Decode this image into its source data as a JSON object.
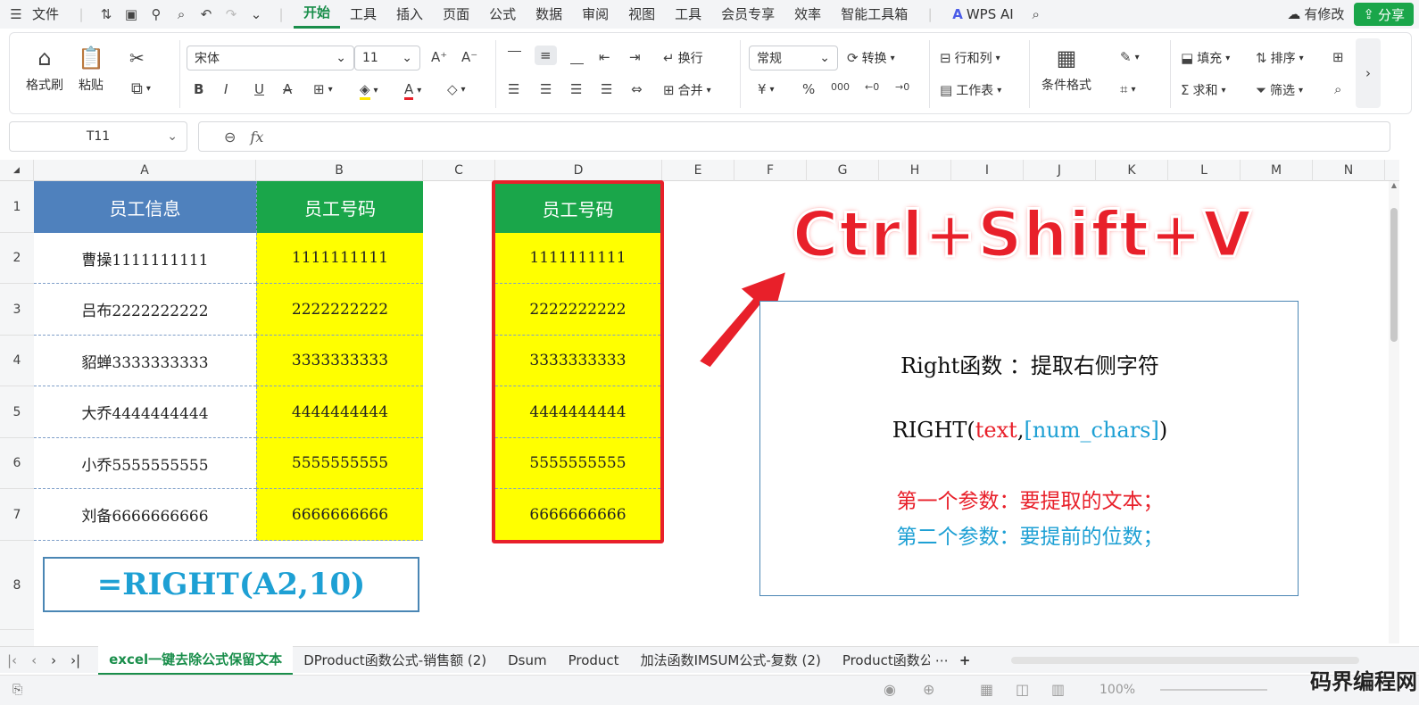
{
  "menubar": {
    "file": "文件",
    "tabs": [
      "开始",
      "工具",
      "插入",
      "页面",
      "公式",
      "数据",
      "审阅",
      "视图",
      "工具",
      "会员专享",
      "效率",
      "智能工具箱"
    ],
    "wps_ai": "WPS AI",
    "modified": "有修改",
    "share": "分享"
  },
  "ribbon": {
    "format_painter": "格式刷",
    "paste": "粘贴",
    "font_name": "宋体",
    "font_size": "11",
    "wrap": "换行",
    "merge": "合并",
    "number_format": "常规",
    "convert": "转换",
    "rows_cols": "行和列",
    "worksheet": "工作表",
    "conditional_format": "条件格式",
    "fill": "填充",
    "sort": "排序",
    "sum": "求和",
    "filter": "筛选",
    "currency": "¥",
    "percent": "%",
    "thousands": "000"
  },
  "formula_bar": {
    "cell_ref": "T11",
    "fx": "fx"
  },
  "columns": [
    "A",
    "B",
    "C",
    "D",
    "E",
    "F",
    "G",
    "H",
    "I",
    "J",
    "K",
    "L",
    "M",
    "N"
  ],
  "rows": [
    "1",
    "2",
    "3",
    "4",
    "5",
    "6",
    "7",
    "8"
  ],
  "sheet": {
    "a_header": "员工信息",
    "b_header": "员工号码",
    "d_header": "员工号码",
    "names": [
      "曹操1111111111",
      "吕布2222222222",
      "貂蝉3333333333",
      "大乔4444444444",
      "小乔5555555555",
      "刘备6666666666"
    ],
    "numbers": [
      "1111111111",
      "2222222222",
      "3333333333",
      "4444444444",
      "5555555555",
      "6666666666"
    ],
    "d_numbers": [
      "1111111111",
      "2222222222",
      "3333333333",
      "4444444444",
      "5555555555",
      "6666666666"
    ],
    "formula": "=RIGHT(A2,10)"
  },
  "annotation": {
    "shortcut": "Ctrl+Shift+V",
    "line1": "Right函数 ：提取右侧字符",
    "syntax_pre": "RIGHT(",
    "syntax_text": "text",
    "syntax_comma": ",",
    "syntax_num": "[num_chars]",
    "syntax_post": ")",
    "param1": "第一个参数：要提取的文本；",
    "param2": "第二个参数：要提前的位数；"
  },
  "tabs": [
    "excel一键去除公式保留文本",
    "DProduct函数公式-销售额 (2)",
    "Dsum",
    "Product",
    "加法函数IMSUM公式-复数 (2)",
    "Product函数公式"
  ],
  "status": {
    "zoom": "100%"
  },
  "watermark": "码界编程网",
  "colors": {
    "accent": "#1a8e4b",
    "header_blue": "#4f81bd",
    "header_green": "#1aa64a",
    "highlight": "#ffff00",
    "red": "#e8202a",
    "cyan": "#1ea0d4"
  }
}
